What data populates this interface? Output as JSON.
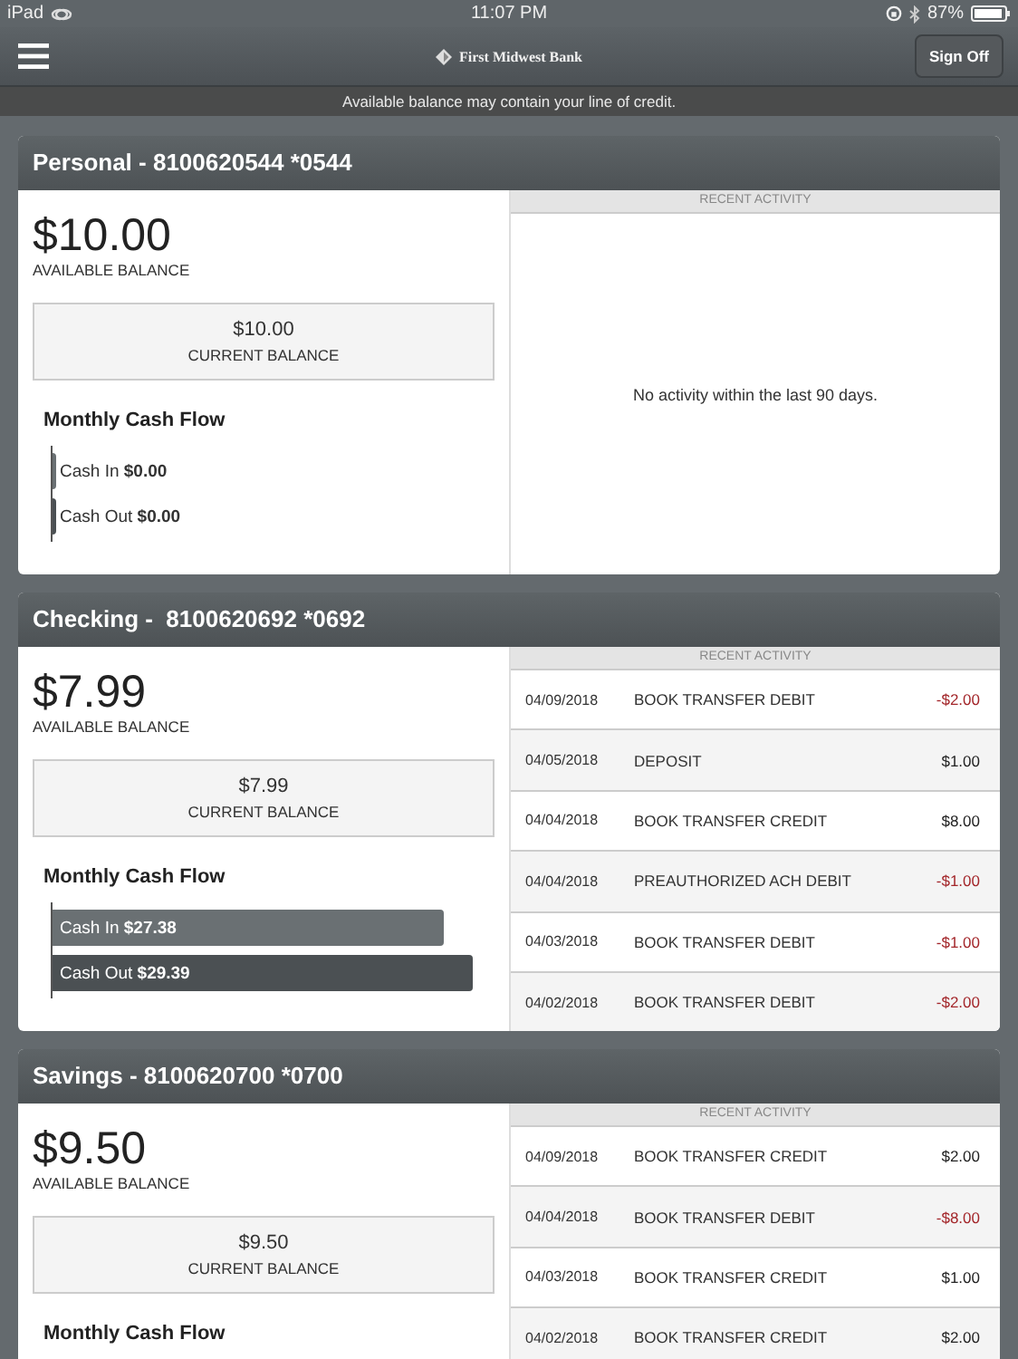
{
  "status_bar": {
    "device": "iPad",
    "time": "11:07 PM",
    "battery": "87%"
  },
  "navbar": {
    "title": "First Midwest Bank",
    "sign_off": "Sign Off"
  },
  "notice": "Available balance may contain your line of credit.",
  "accounts": [
    {
      "title": "Personal - 8100620544 *0544",
      "available": "$10.00",
      "available_label": "AVAILABLE BALANCE",
      "current": "$10.00",
      "current_label": "CURRENT BALANCE",
      "cash_flow_title": "Monthly Cash Flow",
      "cash_flow": [
        {
          "label": "Cash In",
          "amount": "$0.00",
          "level": 0
        },
        {
          "label": "Cash Out",
          "amount": "$0.00",
          "level": 0
        }
      ],
      "activity_header": "RECENT ACTIVITY",
      "empty_message": "No activity within the last 90 days."
    },
    {
      "title": "Checking -  8100620692 *0692",
      "available": "$7.99",
      "available_label": "AVAILABLE BALANCE",
      "current": "$7.99",
      "current_label": "CURRENT BALANCE",
      "cash_flow_title": "Monthly Cash Flow",
      "cash_flow": [
        {
          "label": "Cash In",
          "amount": "$27.38",
          "level": 0.9
        },
        {
          "label": "Cash Out",
          "amount": "$29.39",
          "level": 0.965
        }
      ],
      "activity_header": "RECENT ACTIVITY",
      "activity": [
        {
          "date": "04/09/2018",
          "description": "BOOK TRANSFER DEBIT",
          "amount": "-$2.00",
          "negative": true
        },
        {
          "date": "04/05/2018",
          "description": "DEPOSIT",
          "amount": "$1.00",
          "negative": false
        },
        {
          "date": "04/04/2018",
          "description": "BOOK TRANSFER CREDIT",
          "amount": "$8.00",
          "negative": false
        },
        {
          "date": "04/04/2018",
          "description": "PREAUTHORIZED ACH DEBIT",
          "amount": "-$1.00",
          "negative": true
        },
        {
          "date": "04/03/2018",
          "description": "BOOK TRANSFER DEBIT",
          "amount": "-$1.00",
          "negative": true
        },
        {
          "date": "04/02/2018",
          "description": "BOOK TRANSFER DEBIT",
          "amount": "-$2.00",
          "negative": true
        }
      ]
    },
    {
      "title": "Savings - 8100620700 *0700",
      "available": "$9.50",
      "available_label": "AVAILABLE BALANCE",
      "current": "$9.50",
      "current_label": "CURRENT BALANCE",
      "cash_flow_title": "Monthly Cash Flow",
      "activity_header": "RECENT ACTIVITY",
      "activity": [
        {
          "date": "04/09/2018",
          "description": "BOOK TRANSFER CREDIT",
          "amount": "$2.00",
          "negative": false
        },
        {
          "date": "04/04/2018",
          "description": "BOOK TRANSFER DEBIT",
          "amount": "-$8.00",
          "negative": true
        },
        {
          "date": "04/03/2018",
          "description": "BOOK TRANSFER CREDIT",
          "amount": "$1.00",
          "negative": false
        },
        {
          "date": "04/02/2018",
          "description": "BOOK TRANSFER CREDIT",
          "amount": "$2.00",
          "negative": false
        }
      ]
    }
  ]
}
